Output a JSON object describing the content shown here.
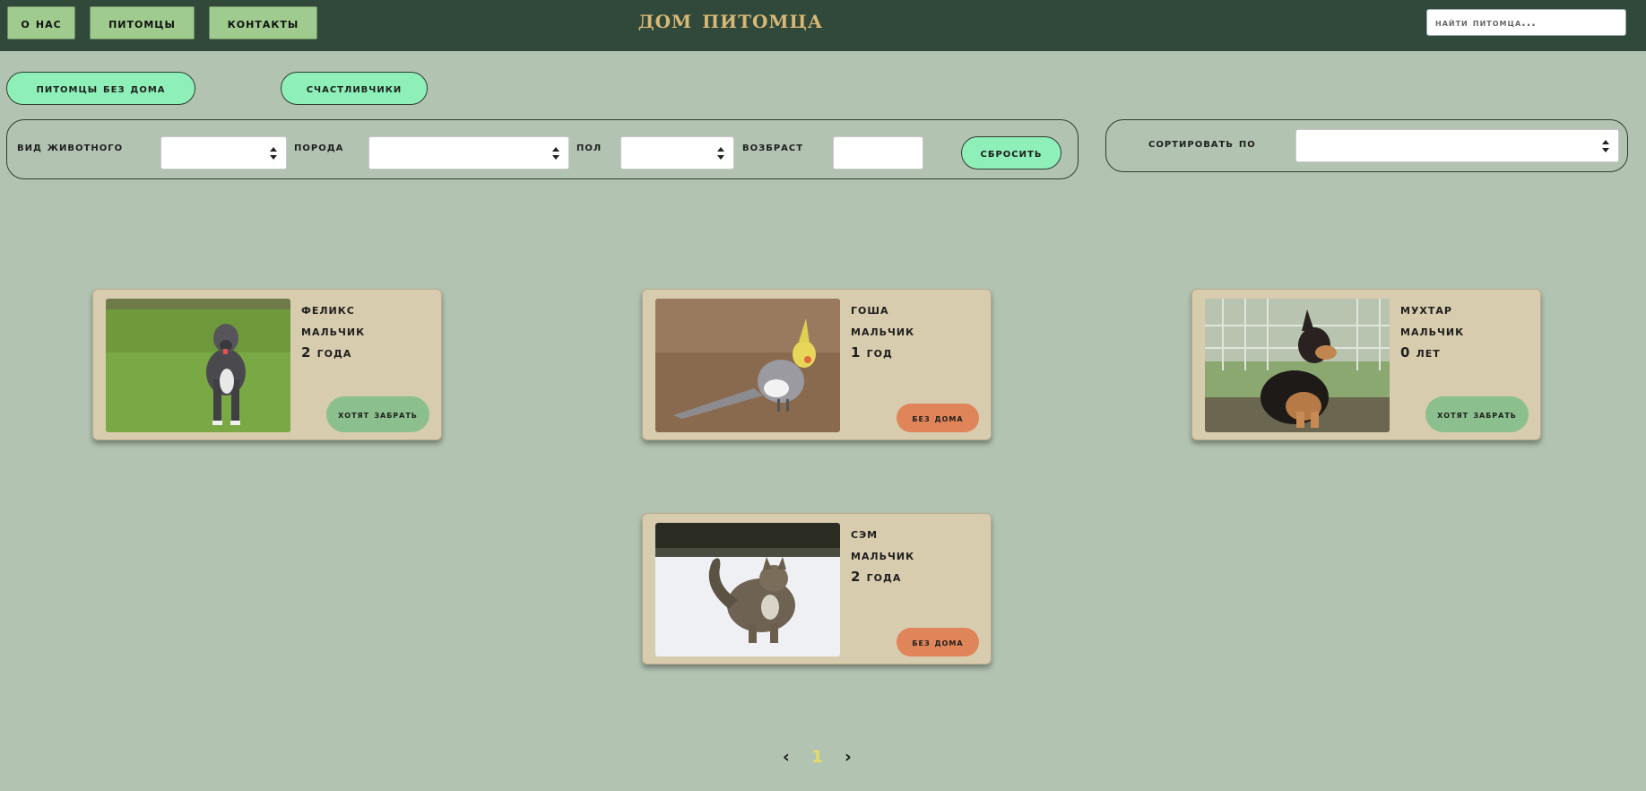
{
  "header": {
    "nav": [
      "о нас",
      "питомцы",
      "контакты"
    ],
    "title": "дом питомца",
    "search_placeholder": "найти питомца..."
  },
  "toggles": {
    "homeless": "питомцы без дома",
    "lucky": "счастливчики"
  },
  "filters": {
    "species_label": "вид животного",
    "breed_label": "порода",
    "gender_label": "пол",
    "age_label": "возбраст",
    "reset_label": "сбросить",
    "sort_label": "сортировать по"
  },
  "pets": [
    {
      "name": "феликс",
      "gender": "мальчик",
      "age": "2 года",
      "status": "хотят забрать",
      "photo": "dog-pitbull"
    },
    {
      "name": "гоша",
      "gender": "мальчик",
      "age": "1 год",
      "status": "без дома",
      "photo": "cockatiel"
    },
    {
      "name": "мухтар",
      "gender": "мальчик",
      "age": "0 лет",
      "status": "хотят забрать",
      "photo": "shepherd-puppy"
    },
    {
      "name": "сэм",
      "gender": "мальчик",
      "age": "2 года",
      "status": "без дома",
      "photo": "cat-in-snow"
    }
  ],
  "pagination": {
    "prev": "‹",
    "current": "1",
    "next": "›"
  },
  "colors": {
    "background": "#b2c3b2",
    "header": "#30493a",
    "title": "#d8b777",
    "nav_button": "#9fcc8e",
    "pill": "#8ef0b8",
    "card": "#d8ccae",
    "status_wanted": "#8bbf8d",
    "status_homeless": "#e0845a",
    "page_current": "#e3dc6d"
  }
}
